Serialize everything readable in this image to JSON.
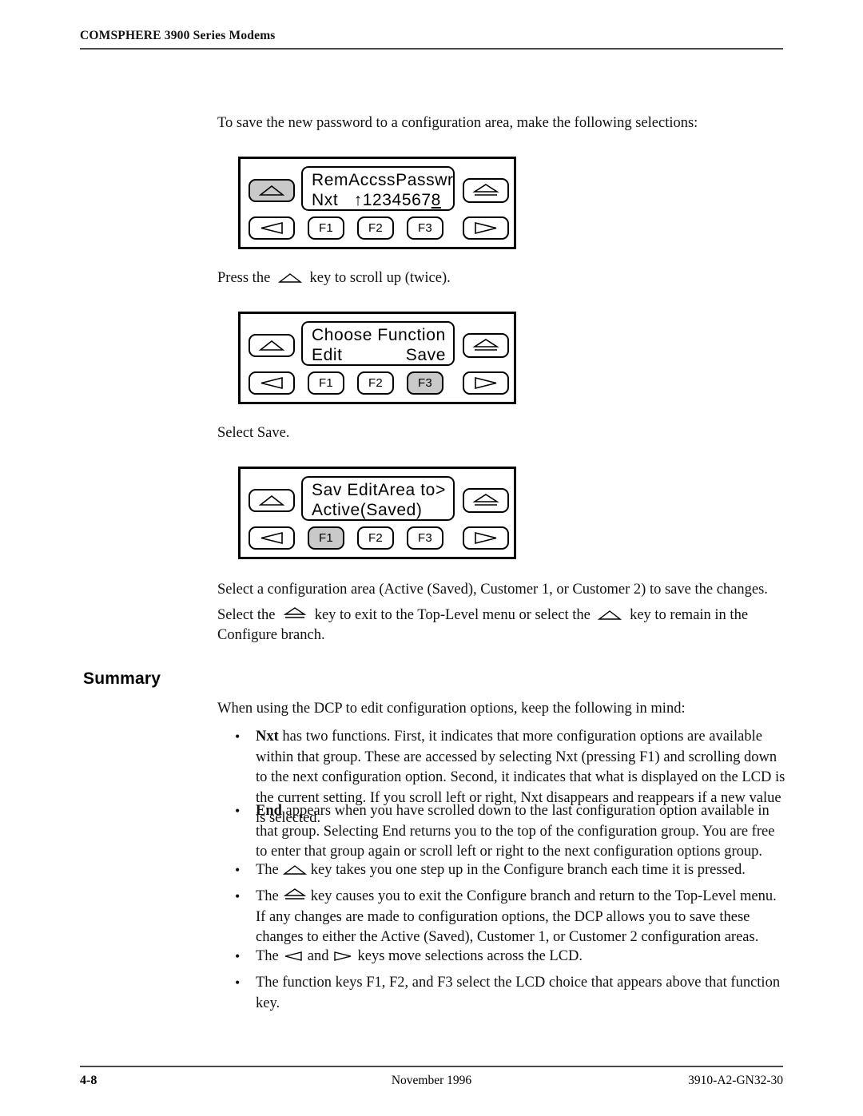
{
  "header": {
    "title": "COMSPHERE 3900 Series Modems"
  },
  "intro": {
    "save_instruction": "To save the new password to a configuration area, make the following selections:",
    "press_up_before": "Press the",
    "press_up_after": "key to scroll up (twice).",
    "select_save": "Select Save.",
    "select_area": "Select a configuration area (Active (Saved), Customer 1, or Customer 2) to save the changes.",
    "exit_before": "Select the",
    "exit_middle": "key to exit to the Top-Level menu or select the",
    "exit_after": "key to remain in the Configure branch."
  },
  "panels": [
    {
      "name": "rem-access-password",
      "lcd_line1": "RemAccssPasswrd:",
      "lcd_line2_prefix": "Nxt   ↑1234567",
      "lcd_line2_underlined": "8",
      "keys": {
        "up": "up-arrow-key",
        "top_level": "top-level-key",
        "left": "left-arrow-key",
        "right": "right-arrow-key",
        "f1": "F1",
        "f2": "F2",
        "f3": "F3"
      },
      "highlighted": "up"
    },
    {
      "name": "choose-function",
      "lcd_line1": "Choose Function",
      "lcd_line2_left": "Edit",
      "lcd_line2_right": "Save",
      "keys": {
        "up": "up-arrow-key",
        "top_level": "top-level-key",
        "left": "left-arrow-key",
        "right": "right-arrow-key",
        "f1": "F1",
        "f2": "F2",
        "f3": "F3"
      },
      "highlighted": "f3"
    },
    {
      "name": "save-edit-area",
      "lcd_line1_left": "Sav EditArea to",
      "lcd_line1_right": ">",
      "lcd_line2": "Active(Saved)",
      "keys": {
        "up": "up-arrow-key",
        "top_level": "top-level-key",
        "left": "left-arrow-key",
        "right": "right-arrow-key",
        "f1": "F1",
        "f2": "F2",
        "f3": "F3"
      },
      "highlighted": "f1"
    }
  ],
  "summary": {
    "heading": "Summary",
    "intro": "When using the DCP to edit configuration options, keep the following in mind:",
    "bullet_char": "•",
    "bullets": [
      {
        "lead": "Nxt",
        "text": " has two functions. First, it indicates that more configuration options are available within that group. These are accessed by selecting Nxt (pressing F1) and scrolling down to the next configuration option. Second, it indicates that what is displayed on the LCD is the current setting. If you scroll left or right, Nxt disappears and reappears if a new value is selected."
      },
      {
        "lead": "End",
        "text": " appears when you have scrolled down to the last configuration option available in that group. Selecting End returns you to the top of the configuration group. You are free to enter that group again or scroll left or right to the next configuration options group."
      },
      {
        "lead": "",
        "prefix": "The",
        "glyph": "up-arrow",
        "text": "key takes you one step up in the Configure branch each time it is pressed."
      },
      {
        "lead": "",
        "prefix": "The",
        "glyph": "top-level",
        "text": "key causes you to exit the Configure branch and return to the Top-Level menu. If any changes are made to configuration options, the DCP allows you to save these changes to either the Active (Saved), Customer 1, or Customer 2 configuration areas."
      },
      {
        "lead": "",
        "prefix": "The",
        "glyph": "left-right",
        "mid": "and",
        "text": "keys move selections across the LCD."
      },
      {
        "lead": "",
        "text": "The function keys F1, F2, and F3 select the LCD choice that appears above that function key."
      }
    ]
  },
  "footer": {
    "page_number": "4-8",
    "date": "November 1996",
    "doc_number": "3910-A2-GN32-30"
  }
}
